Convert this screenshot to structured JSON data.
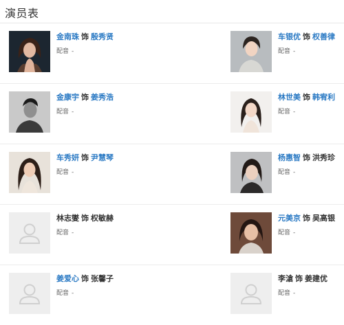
{
  "page_title": "演员表",
  "role_word": "饰",
  "voice_label": "配音",
  "voice_value": "-",
  "colors": {
    "link": "#2b7ac4",
    "text": "#333333",
    "muted": "#666666",
    "divider": "#ececec"
  },
  "cast": [
    {
      "actor": "金南珠",
      "actor_linked": true,
      "role": "殷秀贤",
      "role_linked": true,
      "photo": "portrait"
    },
    {
      "actor": "车银优",
      "actor_linked": true,
      "role": "权善律",
      "role_linked": true,
      "photo": "portrait"
    },
    {
      "actor": "金康宇",
      "actor_linked": true,
      "role": "姜秀浩",
      "role_linked": true,
      "photo": "portrait"
    },
    {
      "actor": "林世美",
      "actor_linked": true,
      "role": "韩宥利",
      "role_linked": true,
      "photo": "portrait"
    },
    {
      "actor": "车秀妍",
      "actor_linked": true,
      "role": "尹慧琴",
      "role_linked": true,
      "photo": "portrait"
    },
    {
      "actor": "杨惠智",
      "actor_linked": true,
      "role": "洪秀珍",
      "role_linked": false,
      "photo": "portrait"
    },
    {
      "actor": "林志燮",
      "actor_linked": false,
      "role": "权敏赫",
      "role_linked": false,
      "photo": "placeholder"
    },
    {
      "actor": "元美京",
      "actor_linked": true,
      "role": "吴高银",
      "role_linked": false,
      "photo": "portrait"
    },
    {
      "actor": "姜爱心",
      "actor_linked": true,
      "role": "张馨子",
      "role_linked": false,
      "photo": "placeholder"
    },
    {
      "actor": "李滄",
      "actor_linked": false,
      "role": "姜建优",
      "role_linked": false,
      "photo": "placeholder"
    }
  ]
}
